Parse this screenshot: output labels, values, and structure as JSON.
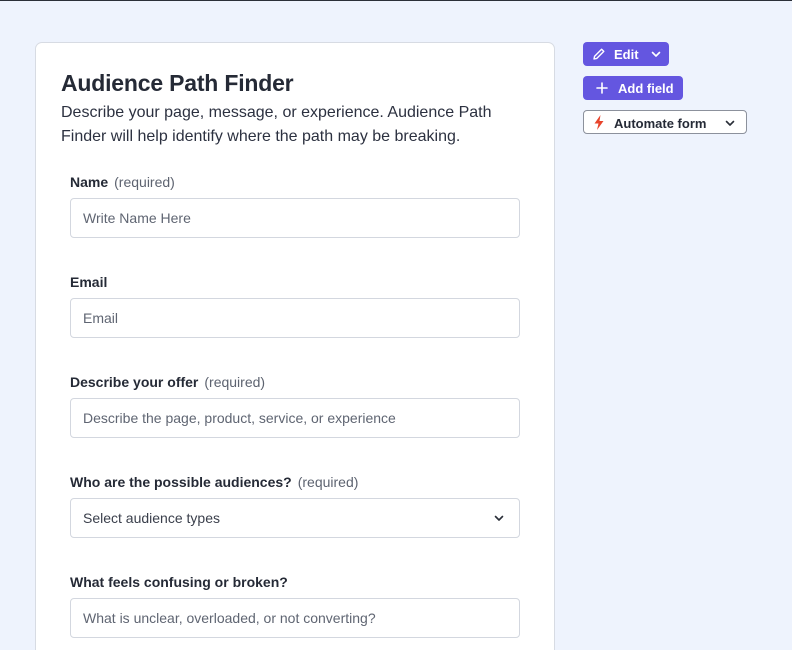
{
  "form": {
    "title": "Audience Path Finder",
    "description": "Describe your page, message, or experience. Audience Path Finder will help identify where the path may be breaking.",
    "fields": [
      {
        "label": "Name",
        "required_note": "(required)",
        "placeholder": "Write Name Here"
      },
      {
        "label": "Email",
        "required_note": "",
        "placeholder": "Email"
      },
      {
        "label": "Describe your offer",
        "required_note": "(required)",
        "placeholder": "Describe the page, product, service, or experience"
      },
      {
        "label": "Who are the possible audiences?",
        "required_note": "(required)",
        "placeholder": "Select audience types"
      },
      {
        "label": "What feels confusing or broken?",
        "required_note": "",
        "placeholder": "What is unclear, overloaded, or not converting?"
      }
    ]
  },
  "toolbar": {
    "edit_label": "Edit",
    "add_field_label": "Add field",
    "automate_label": "Automate form"
  },
  "icons": {
    "edit": "pencil-icon",
    "edit_dropdown": "chevron-down-icon",
    "add": "plus-icon",
    "automate": "lightning-icon",
    "automate_dropdown": "chevron-down-icon",
    "select": "chevron-down-icon"
  },
  "colors": {
    "accent": "#6456e0",
    "lightning": "#e8452c",
    "background": "#eef3fd"
  }
}
